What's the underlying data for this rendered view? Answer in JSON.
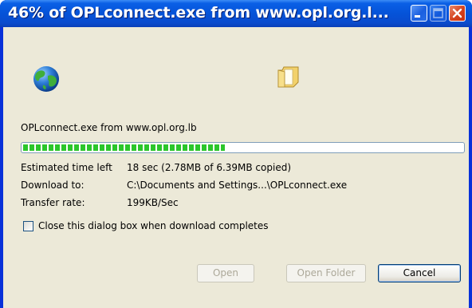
{
  "window": {
    "title": "46% of OPLconnect.exe from www.opl.org.l..."
  },
  "titlebar_buttons": [
    "minimize-icon",
    "maximize-icon",
    "close-icon"
  ],
  "icons": {
    "source": "globe-icon",
    "destination": "folder-icon"
  },
  "download": {
    "source_text": "OPLconnect.exe from www.opl.org.lb",
    "progress_percent": 46,
    "progress_color": "#2bc62b"
  },
  "details": {
    "time_label": "Estimated time left",
    "time_value": "18 sec (2.78MB of 6.39MB copied)",
    "download_to_label": "Download to:",
    "download_to_value": "C:\\Documents and Settings...\\OPLconnect.exe",
    "rate_label": "Transfer rate:",
    "rate_value": "199KB/Sec"
  },
  "options": {
    "close_when_complete_label": "Close this dialog box when download completes",
    "close_when_complete_checked": false
  },
  "buttons": {
    "open": "Open",
    "open_folder": "Open Folder",
    "cancel": "Cancel"
  }
}
